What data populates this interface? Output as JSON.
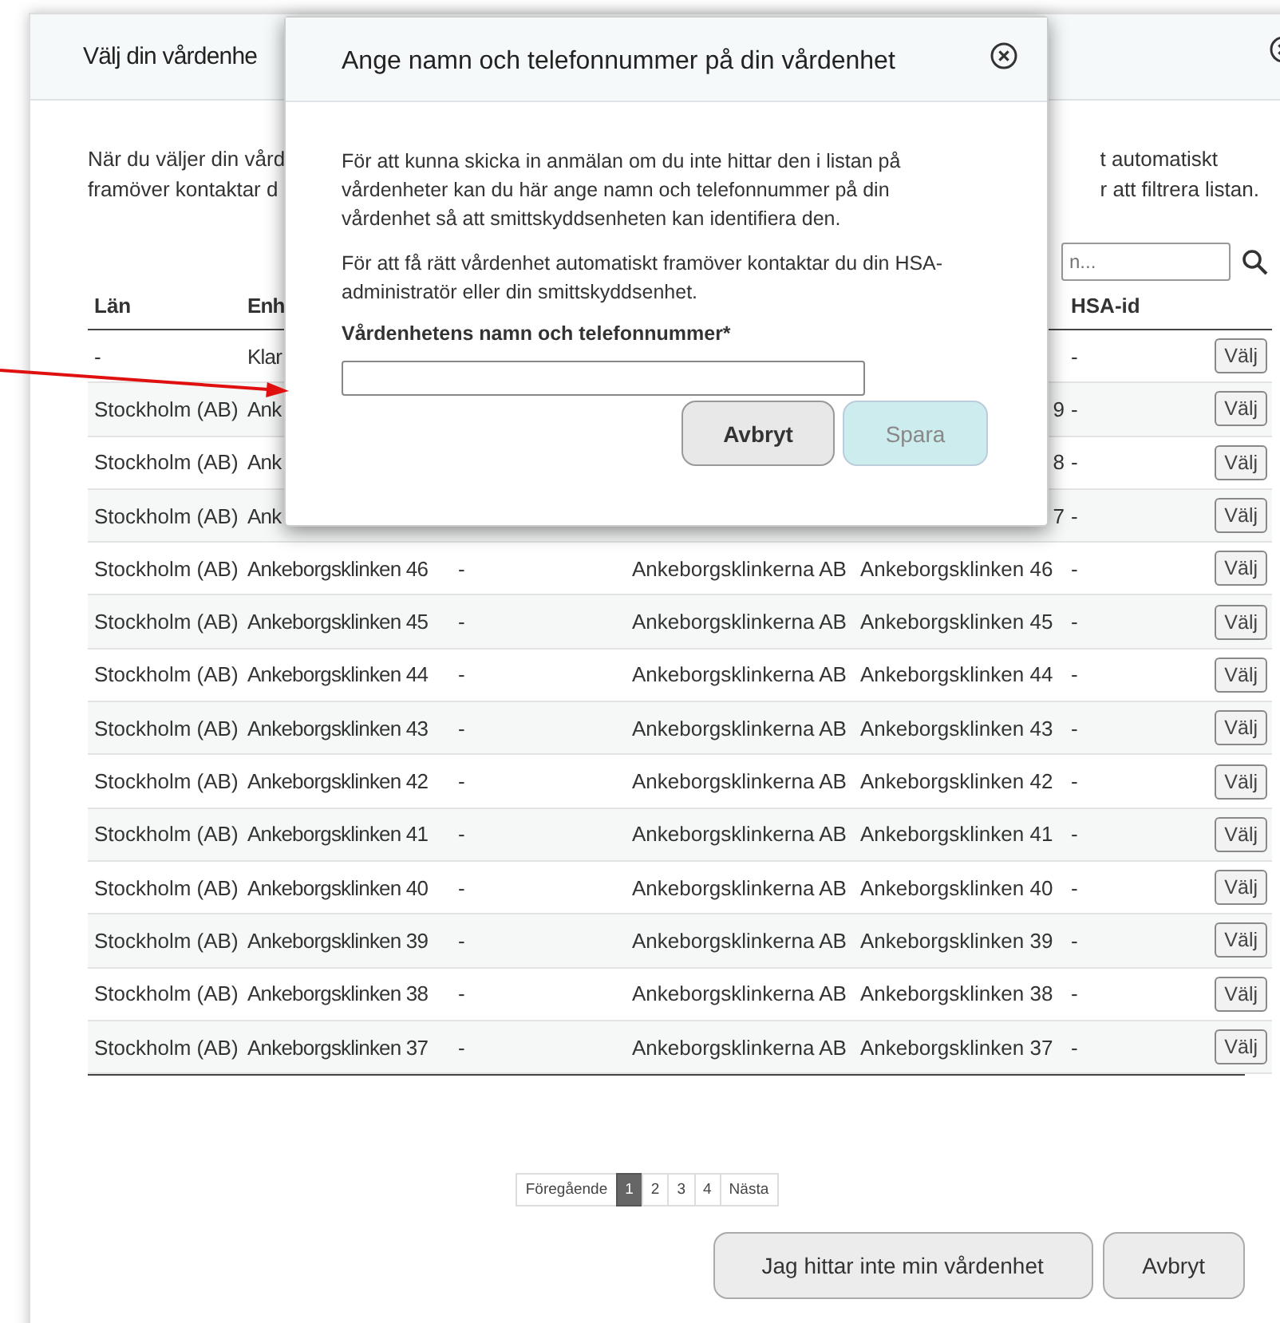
{
  "dialog": {
    "title": "Välj din vårdenhe",
    "intro_left": [
      "När du väljer din vård",
      "framöver kontaktar d"
    ],
    "intro_right": [
      "t automatiskt",
      "r att filtrera listan."
    ],
    "search": {
      "placeholder": "n..."
    },
    "table": {
      "header": {
        "lan": "Län",
        "enhet": "Enh",
        "hsa_id": "HSA-id"
      },
      "rows": [
        {
          "lan": "-",
          "enhet": "Klar",
          "hsa_id": "-",
          "button": "Välj"
        },
        {
          "lan": "Stockholm (AB)",
          "enhet": "Ank",
          "column_5": "9",
          "hsa_id": "-",
          "button": "Välj"
        },
        {
          "lan": "Stockholm (AB)",
          "enhet": "Ank",
          "column_5": "8",
          "hsa_id": "-",
          "button": "Välj"
        },
        {
          "lan": "Stockholm (AB)",
          "enhet": "Ank",
          "column_5": "7",
          "hsa_id": "-",
          "button": "Välj"
        },
        {
          "lan": "Stockholm (AB)",
          "enhet": "Ankeborgsklinken 46",
          "column_3": "-",
          "vardgivare": "Ankeborgsklinkerna AB",
          "column_5": "Ankeborgsklinken 46",
          "hsa_id": "-",
          "button": "Välj"
        },
        {
          "lan": "Stockholm (AB)",
          "enhet": "Ankeborgsklinken 45",
          "column_3": "-",
          "vardgivare": "Ankeborgsklinkerna AB",
          "column_5": "Ankeborgsklinken 45",
          "hsa_id": "-",
          "button": "Välj"
        },
        {
          "lan": "Stockholm (AB)",
          "enhet": "Ankeborgsklinken 44",
          "column_3": "-",
          "vardgivare": "Ankeborgsklinkerna AB",
          "column_5": "Ankeborgsklinken 44",
          "hsa_id": "-",
          "button": "Välj"
        },
        {
          "lan": "Stockholm (AB)",
          "enhet": "Ankeborgsklinken 43",
          "column_3": "-",
          "vardgivare": "Ankeborgsklinkerna AB",
          "column_5": "Ankeborgsklinken 43",
          "hsa_id": "-",
          "button": "Välj"
        },
        {
          "lan": "Stockholm (AB)",
          "enhet": "Ankeborgsklinken 42",
          "column_3": "-",
          "vardgivare": "Ankeborgsklinkerna AB",
          "column_5": "Ankeborgsklinken 42",
          "hsa_id": "-",
          "button": "Välj"
        },
        {
          "lan": "Stockholm (AB)",
          "enhet": "Ankeborgsklinken 41",
          "column_3": "-",
          "vardgivare": "Ankeborgsklinkerna AB",
          "column_5": "Ankeborgsklinken 41",
          "hsa_id": "-",
          "button": "Välj"
        },
        {
          "lan": "Stockholm (AB)",
          "enhet": "Ankeborgsklinken 40",
          "column_3": "-",
          "vardgivare": "Ankeborgsklinkerna AB",
          "column_5": "Ankeborgsklinken 40",
          "hsa_id": "-",
          "button": "Välj"
        },
        {
          "lan": "Stockholm (AB)",
          "enhet": "Ankeborgsklinken 39",
          "column_3": "-",
          "vardgivare": "Ankeborgsklinkerna AB",
          "column_5": "Ankeborgsklinken 39",
          "hsa_id": "-",
          "button": "Välj"
        },
        {
          "lan": "Stockholm (AB)",
          "enhet": "Ankeborgsklinken 38",
          "column_3": "-",
          "vardgivare": "Ankeborgsklinkerna AB",
          "column_5": "Ankeborgsklinken 38",
          "hsa_id": "-",
          "button": "Välj"
        },
        {
          "lan": "Stockholm (AB)",
          "enhet": "Ankeborgsklinken 37",
          "column_3": "-",
          "vardgivare": "Ankeborgsklinkerna AB",
          "column_5": "Ankeborgsklinken 37",
          "hsa_id": "-",
          "button": "Välj"
        }
      ]
    },
    "pagination": [
      {
        "label": "Föregående",
        "selected": false
      },
      {
        "label": "1",
        "selected": true
      },
      {
        "label": "2",
        "selected": false
      },
      {
        "label": "3",
        "selected": false
      },
      {
        "label": "4",
        "selected": false
      },
      {
        "label": "Nästa",
        "selected": false
      }
    ],
    "buttons": [
      "Jag hittar inte min vårdenhet",
      "Avbryt"
    ]
  },
  "modal": {
    "title": "Ange namn och telefonnummer på din vårdenhet",
    "paragraphs": [
      "För att kunna skicka in anmälan om du inte hittar den i listan på vårdenheter kan du här ange namn och telefonnummer på din vårdenhet så att smittskyddsenheten kan identifiera den.",
      "För att få rätt vårdenhet automatiskt framöver kontaktar du din HSA-administratör eller din smittskyddsenhet."
    ],
    "field_label": "Vårdenhetens namn och telefonnummer*",
    "buttons": [
      {
        "label": "Avbryt",
        "disabled": false
      },
      {
        "label": "Spara",
        "disabled": true
      }
    ]
  }
}
